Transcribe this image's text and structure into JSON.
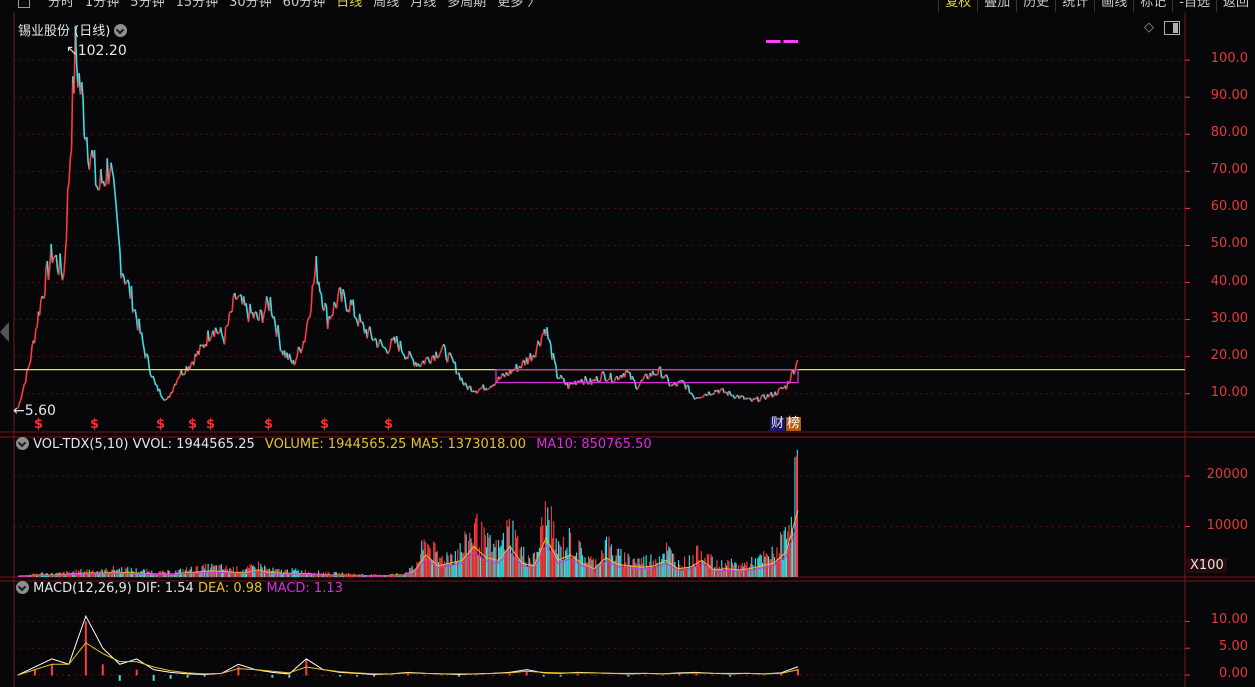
{
  "topbar": {
    "period_tabs": [
      "分时",
      "1分钟",
      "5分钟",
      "15分钟",
      "30分钟",
      "60分钟",
      "日线",
      "周线",
      "月线",
      "多周期",
      "更多 〉"
    ],
    "active_period": "日线",
    "right_tabs": [
      "复权",
      "叠加",
      "历史",
      "统计",
      "画线",
      "标记",
      "-自选",
      "返回"
    ],
    "active_right": "复权"
  },
  "price_pane": {
    "title": "锡业股份 (日线)",
    "high_label": "102.20",
    "low_label": "5.60",
    "y_ticks": [
      "100.0",
      "90.00",
      "80.00",
      "70.00",
      "60.00",
      "50.00",
      "40.00",
      "30.00",
      "20.00",
      "10.00"
    ],
    "dividend_marker": "$",
    "tag_cai": "财",
    "tag_bang": "榜",
    "colors": {
      "up": "#ff3b3b",
      "down": "#39e0e8",
      "hline": "#e5e52a",
      "box": "#d830d8"
    }
  },
  "volume_pane": {
    "title": "VOL-TDX(5,10)",
    "vvol": "VVOL: 1944565.25",
    "volume": "VOLUME: 1944565.25",
    "ma5": "MA5: 1373018.00",
    "ma10": "MA10: 850765.50",
    "y_ticks": [
      "20000",
      "10000"
    ],
    "unit": "X100",
    "colors": {
      "volume": "#e5c22a",
      "ma5": "#e5c22a",
      "ma10": "#d830d8"
    }
  },
  "macd_pane": {
    "title": "MACD(12,26,9)",
    "dif": "DIF: 1.54",
    "dea": "DEA: 0.98",
    "macd": "MACD: 1.13",
    "y_ticks": [
      "10.00",
      "5.00",
      "0.00"
    ],
    "colors": {
      "dif": "#ffffff",
      "dea": "#e5c22a",
      "macd": "#d830d8"
    }
  },
  "chart_data": {
    "type": "line",
    "title": "锡业股份 (日线)",
    "price_ylim": [
      5.6,
      102.2
    ],
    "price_series": [
      6,
      18,
      35,
      48,
      42,
      102.2,
      80,
      65,
      72,
      45,
      35,
      22,
      12,
      8,
      15,
      18,
      22,
      28,
      25,
      36,
      32,
      30,
      35,
      22,
      18,
      25,
      44,
      30,
      36,
      34,
      28,
      25,
      22,
      24,
      20,
      18,
      20,
      22,
      18,
      12,
      11,
      12,
      14,
      16,
      18,
      21,
      28,
      15,
      12,
      14,
      13,
      15,
      14,
      16,
      12,
      15,
      16,
      12,
      13,
      9,
      10,
      11,
      10,
      9,
      8,
      9,
      10,
      12,
      19
    ],
    "hline_value": 16.5,
    "box_range": [
      13,
      16.5
    ],
    "volume_ylim": [
      0,
      24000
    ],
    "volume_series": [
      300,
      500,
      800,
      700,
      900,
      1200,
      1500,
      1300,
      1800,
      1600,
      1400,
      1200,
      1000,
      1100,
      1600,
      1800,
      2200,
      2000,
      1700,
      1600,
      2600,
      1500,
      1300,
      1400,
      1200,
      1000,
      800,
      700,
      600,
      500,
      400,
      600,
      700,
      2000,
      8000,
      4000,
      5000,
      6000,
      11000,
      7000,
      6000,
      11000,
      5000,
      4000,
      14000,
      6000,
      8000,
      5000,
      3000,
      7000,
      4500,
      4000,
      3500,
      4000,
      6000,
      3000,
      3500,
      6000,
      2500,
      3000,
      2500,
      3000,
      4000,
      5000,
      9000,
      24000
    ],
    "macd_ylim": [
      -2,
      14
    ],
    "dif_series": [
      0,
      1.5,
      3,
      2,
      11,
      5,
      2,
      3,
      1,
      0.5,
      0.2,
      0.1,
      0.3,
      2,
      1,
      0.5,
      0.2,
      3,
      1,
      0.5,
      0.3,
      0.1,
      0.2,
      0.5,
      0.3,
      0.2,
      0.1,
      0.2,
      0.3,
      0.5,
      1,
      0.4,
      0.3,
      0.5,
      0.4,
      0.3,
      0.2,
      0.3,
      0.2,
      0.4,
      0.5,
      0.3,
      0.2,
      0.3,
      0.2,
      0.4,
      1.54
    ],
    "dea_series": [
      0,
      1,
      2,
      2,
      6,
      4,
      2.5,
      2.5,
      1.5,
      0.8,
      0.4,
      0.2,
      0.3,
      1.2,
      1,
      0.7,
      0.4,
      1.5,
      1,
      0.6,
      0.4,
      0.2,
      0.2,
      0.4,
      0.3,
      0.2,
      0.2,
      0.2,
      0.3,
      0.4,
      0.7,
      0.5,
      0.4,
      0.4,
      0.4,
      0.3,
      0.3,
      0.3,
      0.2,
      0.3,
      0.4,
      0.3,
      0.3,
      0.3,
      0.2,
      0.3,
      0.98
    ]
  }
}
